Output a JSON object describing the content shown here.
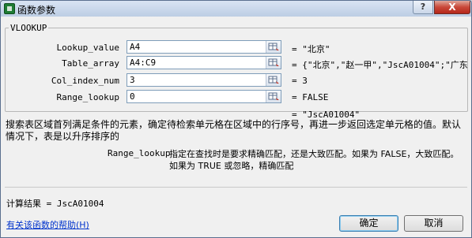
{
  "window": {
    "title": "函数参数",
    "help_glyph": "?",
    "close_glyph": "X"
  },
  "function_group": {
    "name": "VLOOKUP"
  },
  "arguments": [
    {
      "label": "Lookup_value",
      "value": "A4",
      "result": "= \"北京\""
    },
    {
      "label": "Table_array",
      "value": "A4:C9",
      "result": "= {\"北京\",\"赵一甲\",\"JscA01004\";\"广东"
    },
    {
      "label": "Col_index_num",
      "value": "3",
      "result": "= 3"
    },
    {
      "label": "Range_lookup",
      "value": "0",
      "result": "= FALSE"
    }
  ],
  "formula_result": "= \"JscA01004\"",
  "description": "搜索表区域首列满足条件的元素，确定待检索单元格在区域中的行序号，再进一步返回选定单元格的值。默认情况下，表是以升序排序的",
  "param_help": {
    "name": "Range_lookup",
    "text": "指定在查找时是要求精确匹配，还是大致匹配。如果为 FALSE，大致匹配。如果为 TRUE 或忽略，精确匹配"
  },
  "calc_result": "计算结果 =  JscA01004",
  "help_link": "有关该函数的帮助(H)",
  "buttons": {
    "ok": "确定",
    "cancel": "取消"
  },
  "icons": [
    "app-icon",
    "help-icon",
    "close-icon",
    "range-picker-icon"
  ]
}
